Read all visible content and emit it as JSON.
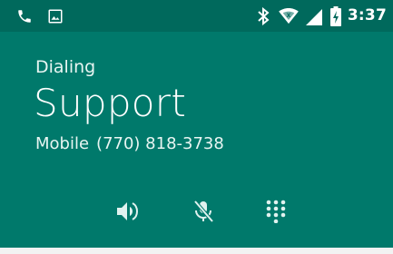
{
  "status_bar": {
    "time": "3:37",
    "icons": [
      "phone-call-notification-icon",
      "image-notification-icon",
      "bluetooth-icon",
      "wifi-icon",
      "cell-signal-icon",
      "battery-charging-icon"
    ]
  },
  "call": {
    "state": "Dialing",
    "contact_name": "Support",
    "number_type": "Mobile",
    "phone_number": "(770) 818-3738"
  },
  "actions": [
    {
      "name": "speaker-icon"
    },
    {
      "name": "mute-icon"
    },
    {
      "name": "dialpad-icon"
    }
  ],
  "colors": {
    "status_bar": "#00695c",
    "call_panel": "#00796b",
    "bottom_area": "#f2f2f2",
    "text": "#ffffff"
  }
}
